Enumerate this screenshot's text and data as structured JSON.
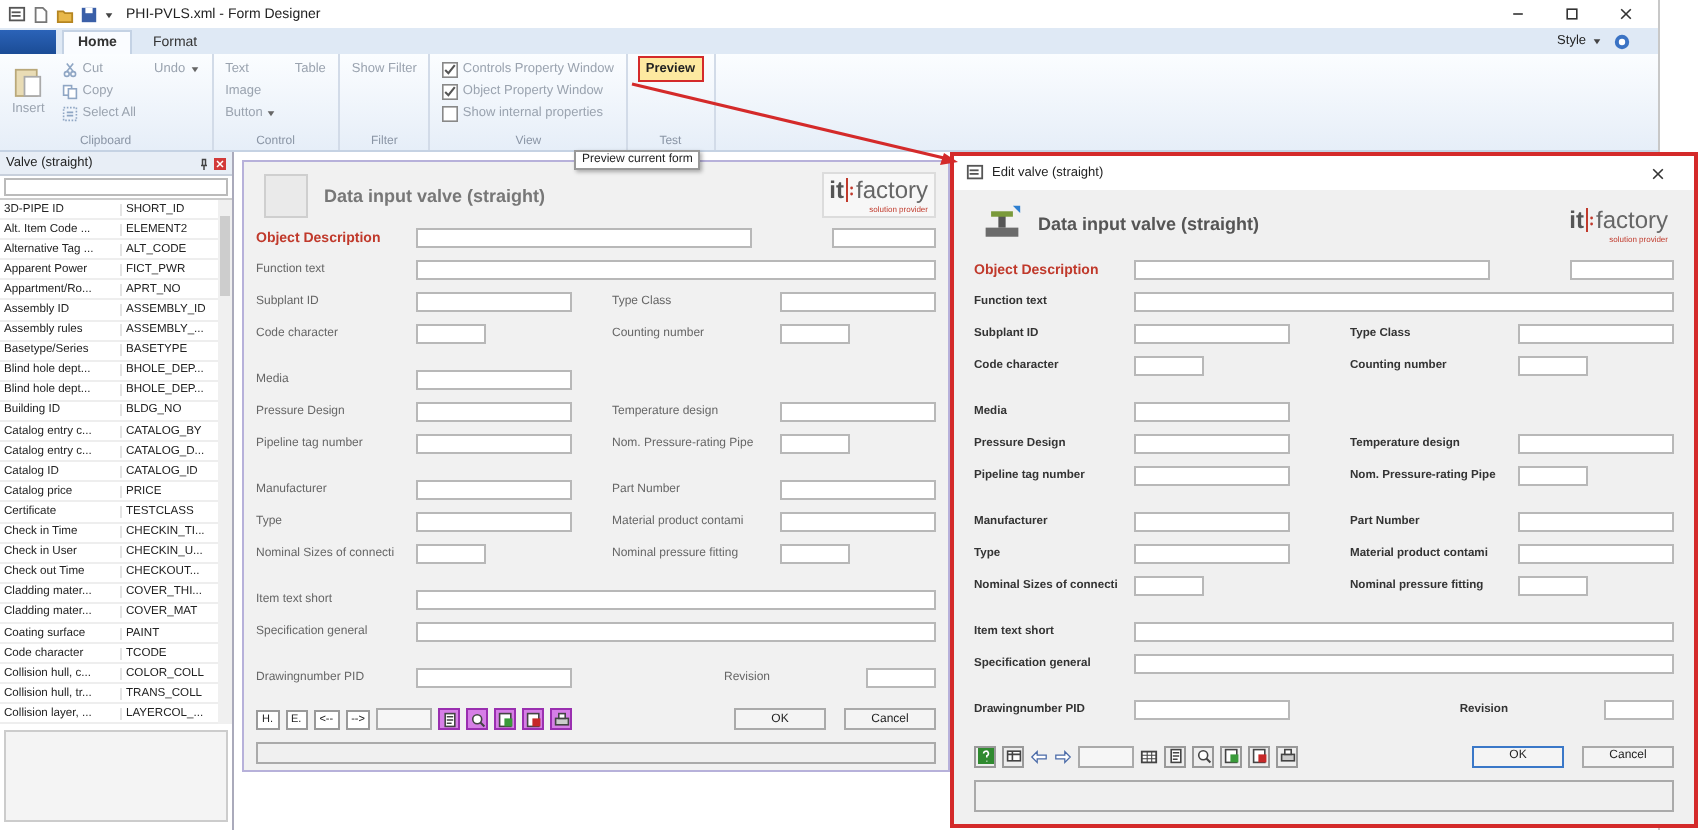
{
  "window": {
    "title": "PHI-PVLS.xml - Form Designer"
  },
  "tabs": [
    {
      "label": "Home",
      "selected": true
    },
    {
      "label": "Format",
      "selected": false
    }
  ],
  "style_menu": {
    "label": "Style"
  },
  "ribbon_groups": [
    {
      "name": "Clipboard",
      "items": [
        {
          "kind": "large",
          "label": "Insert",
          "disabled": true
        },
        {
          "kind": "icon-small",
          "label": "Cut",
          "disabled": true
        },
        {
          "kind": "icon-small",
          "label": "Copy",
          "disabled": true
        },
        {
          "kind": "icon-small",
          "label": "Select All",
          "disabled": true
        },
        {
          "kind": "dropdown",
          "label": "Undo",
          "disabled": true
        }
      ]
    },
    {
      "name": "Control",
      "items": [
        {
          "kind": "small",
          "label": "Text",
          "disabled": true
        },
        {
          "kind": "small",
          "label": "Image",
          "disabled": true
        },
        {
          "kind": "dropdown",
          "label": "Button",
          "disabled": true
        },
        {
          "kind": "small",
          "label": "Table",
          "disabled": true
        }
      ]
    },
    {
      "name": "Filter",
      "items": [
        {
          "kind": "small",
          "label": "Show Filter",
          "disabled": true
        }
      ]
    },
    {
      "name": "View",
      "items": [
        {
          "kind": "check",
          "label": "Controls Property Window",
          "disabled": true,
          "checked": true
        },
        {
          "kind": "check",
          "label": "Object Property Window",
          "disabled": true,
          "checked": true
        },
        {
          "kind": "check",
          "label": "Show internal properties",
          "disabled": true,
          "checked": false
        }
      ]
    },
    {
      "name": "Test",
      "items": [
        {
          "kind": "highlight",
          "label": "Preview",
          "disabled": false
        }
      ]
    }
  ],
  "tooltip": {
    "text": "Preview current form"
  },
  "left_panel": {
    "title": "Valve (straight)",
    "rows": [
      {
        "label": "3D-PIPE ID",
        "code": "SHORT_ID"
      },
      {
        "label": "Alt. Item Code ...",
        "code": "ELEMENT2"
      },
      {
        "label": "Alternative Tag ...",
        "code": "ALT_CODE"
      },
      {
        "label": "Apparent Power",
        "code": "FICT_PWR"
      },
      {
        "label": "Appartment/Ro...",
        "code": "APRT_NO"
      },
      {
        "label": "Assembly ID",
        "code": "ASSEMBLY_ID"
      },
      {
        "label": "Assembly rules",
        "code": "ASSEMBLY_..."
      },
      {
        "label": "Basetype/Series",
        "code": "BASETYPE"
      },
      {
        "label": "Blind hole dept...",
        "code": "BHOLE_DEP..."
      },
      {
        "label": "Blind hole dept...",
        "code": "BHOLE_DEP..."
      },
      {
        "label": "Building ID",
        "code": "BLDG_NO"
      },
      {
        "label": "Catalog entry c...",
        "code": "CATALOG_BY"
      },
      {
        "label": "Catalog entry c...",
        "code": "CATALOG_D..."
      },
      {
        "label": "Catalog ID",
        "code": "CATALOG_ID"
      },
      {
        "label": "Catalog price",
        "code": "PRICE"
      },
      {
        "label": "Certificate",
        "code": "TESTCLASS"
      },
      {
        "label": "Check in Time",
        "code": "CHECKIN_TI..."
      },
      {
        "label": "Check in User",
        "code": "CHECKIN_U..."
      },
      {
        "label": "Check out Time",
        "code": "CHECKOUT..."
      },
      {
        "label": "Cladding mater...",
        "code": "COVER_THI..."
      },
      {
        "label": "Cladding mater...",
        "code": "COVER_MAT"
      },
      {
        "label": "Coating surface",
        "code": "PAINT"
      },
      {
        "label": "Code character",
        "code": "TCODE"
      },
      {
        "label": "Collision hull, c...",
        "code": "COLOR_COLL"
      },
      {
        "label": "Collision hull, tr...",
        "code": "TRANS_COLL"
      },
      {
        "label": "Collision layer, ...",
        "code": "LAYERCOL_..."
      }
    ]
  },
  "designer_form": {
    "title": "Data input valve (straight)",
    "logo": {
      "left": "it",
      "right": "factory",
      "tagline": "solution provider"
    },
    "rows": [
      {
        "kind": "heading",
        "cells": [
          {
            "label": "Object Description",
            "kind": "wide"
          },
          {
            "kind": "short"
          }
        ]
      },
      {
        "kind": "fields",
        "cells": [
          {
            "label": "Function text",
            "kind": "full"
          }
        ]
      },
      {
        "kind": "fields",
        "cells": [
          {
            "label": "Subplant ID",
            "kind": "medium"
          },
          {
            "label": "Type Class",
            "kind": "medium"
          }
        ]
      },
      {
        "kind": "fields",
        "cells": [
          {
            "label": "Code character",
            "kind": "small"
          },
          {
            "label": "Counting number",
            "kind": "small"
          }
        ]
      },
      {
        "kind": "spacer"
      },
      {
        "kind": "fields",
        "cells": [
          {
            "label": "Media",
            "kind": "medium"
          }
        ]
      },
      {
        "kind": "fields",
        "cells": [
          {
            "label": "Pressure Design",
            "kind": "medium"
          },
          {
            "label": "Temperature design",
            "kind": "medium"
          }
        ]
      },
      {
        "kind": "fields",
        "cells": [
          {
            "label": "Pipeline tag number",
            "kind": "medium"
          },
          {
            "label": "Nom. Pressure-rating Pipe",
            "kind": "small"
          }
        ]
      },
      {
        "kind": "spacer"
      },
      {
        "kind": "fields",
        "cells": [
          {
            "label": "Manufacturer",
            "kind": "medium"
          },
          {
            "label": "Part Number",
            "kind": "medium"
          }
        ]
      },
      {
        "kind": "fields",
        "cells": [
          {
            "label": "Type",
            "kind": "medium"
          },
          {
            "label": "Material product contami",
            "kind": "medium"
          }
        ]
      },
      {
        "kind": "fields",
        "cells": [
          {
            "label": "Nominal Sizes of connecti",
            "kind": "small"
          },
          {
            "label": "Nominal pressure fitting",
            "kind": "small"
          }
        ]
      },
      {
        "kind": "spacer"
      },
      {
        "kind": "fields",
        "cells": [
          {
            "label": "Item text short",
            "kind": "full"
          }
        ]
      },
      {
        "kind": "fields",
        "cells": [
          {
            "label": "Specification general",
            "kind": "full"
          }
        ]
      },
      {
        "kind": "spacer"
      },
      {
        "kind": "footer",
        "cells": [
          {
            "label": "Drawingnumber PID",
            "kind": "medium"
          },
          {
            "label": "Revision",
            "kind": "small"
          }
        ]
      }
    ],
    "nav_buttons": [
      "H.",
      "E.",
      "<--",
      "-->"
    ],
    "ok": "OK",
    "cancel": "Cancel"
  },
  "dialog": {
    "title": "Edit valve (straight)",
    "form": {
      "title": "Data input valve (straight)",
      "logo": {
        "left": "it",
        "right": "factory",
        "tagline": "solution provider"
      },
      "rows": [
        {
          "kind": "heading",
          "cells": [
            {
              "label": "Object Description",
              "kind": "wide"
            },
            {
              "kind": "short"
            }
          ]
        },
        {
          "kind": "fields",
          "cells": [
            {
              "label": "Function text",
              "kind": "full"
            }
          ]
        },
        {
          "kind": "fields",
          "cells": [
            {
              "label": "Subplant ID",
              "kind": "medium"
            },
            {
              "label": "Type Class",
              "kind": "medium"
            }
          ]
        },
        {
          "kind": "fields",
          "cells": [
            {
              "label": "Code character",
              "kind": "small"
            },
            {
              "label": "Counting number",
              "kind": "small"
            }
          ]
        },
        {
          "kind": "spacer"
        },
        {
          "kind": "fields",
          "cells": [
            {
              "label": "Media",
              "kind": "medium"
            }
          ]
        },
        {
          "kind": "fields",
          "cells": [
            {
              "label": "Pressure Design",
              "kind": "medium"
            },
            {
              "label": "Temperature design",
              "kind": "medium"
            }
          ]
        },
        {
          "kind": "fields",
          "cells": [
            {
              "label": "Pipeline tag number",
              "kind": "medium"
            },
            {
              "label": "Nom. Pressure-rating Pipe",
              "kind": "small"
            }
          ]
        },
        {
          "kind": "spacer"
        },
        {
          "kind": "fields",
          "cells": [
            {
              "label": "Manufacturer",
              "kind": "medium"
            },
            {
              "label": "Part Number",
              "kind": "medium"
            }
          ]
        },
        {
          "kind": "fields",
          "cells": [
            {
              "label": "Type",
              "kind": "medium"
            },
            {
              "label": "Material product contami",
              "kind": "medium"
            }
          ]
        },
        {
          "kind": "fields",
          "cells": [
            {
              "label": "Nominal Sizes of connecti",
              "kind": "small"
            },
            {
              "label": "Nominal pressure fitting",
              "kind": "small"
            }
          ]
        },
        {
          "kind": "spacer"
        },
        {
          "kind": "fields",
          "cells": [
            {
              "label": "Item text short",
              "kind": "full"
            }
          ]
        },
        {
          "kind": "fields",
          "cells": [
            {
              "label": "Specification general",
              "kind": "full"
            }
          ]
        },
        {
          "kind": "spacer"
        },
        {
          "kind": "footer",
          "cells": [
            {
              "label": "Drawingnumber PID",
              "kind": "medium"
            },
            {
              "label": "Revision",
              "kind": "small"
            }
          ]
        }
      ],
      "ok": "OK",
      "cancel": "Cancel"
    }
  }
}
